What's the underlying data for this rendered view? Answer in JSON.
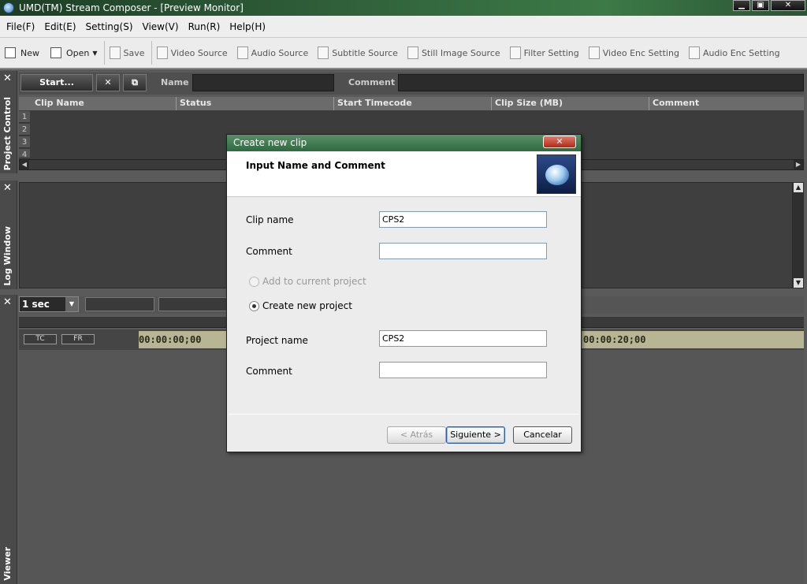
{
  "window": {
    "title": "UMD(TM) Stream Composer - [Preview Monitor]",
    "btn_min": "▁",
    "btn_max": "▣",
    "btn_close": "✕"
  },
  "menu": [
    "File(F)",
    "Edit(E)",
    "Setting(S)",
    "View(V)",
    "Run(R)",
    "Help(H)"
  ],
  "toolbar": {
    "new": "New",
    "open": "Open",
    "save": "Save",
    "video_source": "Video Source",
    "audio_source": "Audio Source",
    "subtitle_source": "Subtitle Source",
    "still_image_source": "Still Image Source",
    "filter_setting": "Filter Setting",
    "video_enc_setting": "Video Enc Setting",
    "audio_enc_setting": "Audio Enc Setting"
  },
  "project_control": {
    "tab_label": "Project Control",
    "start_btn": "Start...",
    "delete_btn": "✕",
    "copy_btn": "⧉",
    "name_label": "Name",
    "comment_label": "Comment",
    "columns": [
      "Clip Name",
      "Status",
      "Start Timecode",
      "Clip Size (MB)",
      "Comment"
    ],
    "rows": [
      "1",
      "2",
      "3",
      "4"
    ]
  },
  "log_window": {
    "tab_label": "Log Window"
  },
  "preview": {
    "tab_label": "Viewer",
    "interval": "1 sec",
    "tc_btn": "TC",
    "fr_btn": "FR",
    "tc_start": "00:00:00;00",
    "tc_mid": "00:00:20;00"
  },
  "dialog": {
    "title": "Create new clip",
    "close": "✕",
    "heading": "Input Name and Comment",
    "clip_name_label": "Clip name",
    "clip_name_value": "CPS2",
    "comment_label": "Comment",
    "comment_value": "",
    "radio_add": "Add to current project",
    "radio_create": "Create new project",
    "project_name_label": "Project name",
    "project_name_value": "CPS2",
    "project_comment_label": "Comment",
    "project_comment_value": "",
    "back_btn": "< Atrás",
    "next_btn": "Siguiente >",
    "cancel_btn": "Cancelar"
  }
}
